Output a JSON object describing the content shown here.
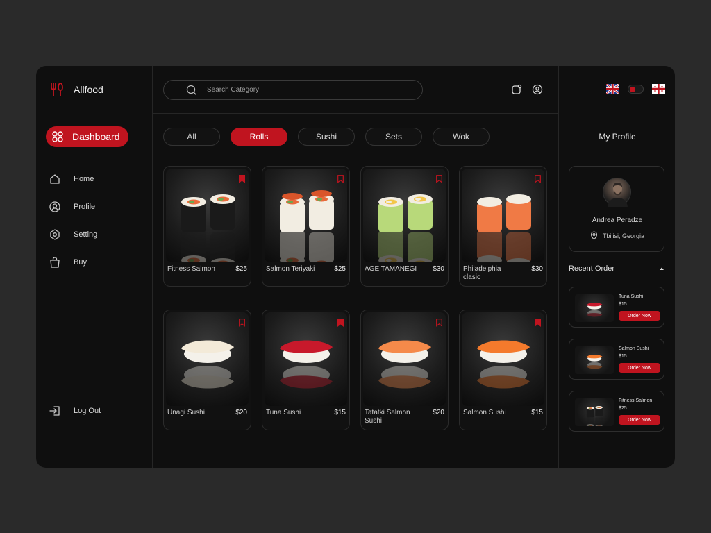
{
  "brand": {
    "name": "Allfood",
    "accent": "#c0141f"
  },
  "sidebar": {
    "dashboard_label": "Dashboard",
    "items": [
      {
        "label": "Home",
        "icon": "home-icon"
      },
      {
        "label": "Profile",
        "icon": "user-icon"
      },
      {
        "label": "Setting",
        "icon": "settings-icon"
      },
      {
        "label": "Buy",
        "icon": "shopping-bag-icon"
      }
    ],
    "logout_label": "Log Out"
  },
  "search": {
    "placeholder": "Search Category"
  },
  "tabs": [
    {
      "label": "All",
      "active": false
    },
    {
      "label": "Rolls",
      "active": true
    },
    {
      "label": "Sushi",
      "active": false
    },
    {
      "label": "Sets",
      "active": false
    },
    {
      "label": "Wok",
      "active": false
    }
  ],
  "products": [
    {
      "name": "Fitness Salmon",
      "price": "$25",
      "kind": "roll-nori"
    },
    {
      "name": "Salmon Teriyaki",
      "price": "$25",
      "kind": "roll-teriyaki"
    },
    {
      "name": "AGE TAMANEGI",
      "price": "$30",
      "kind": "roll-avocado"
    },
    {
      "name": "Philadelphia clasic",
      "price": "$30",
      "kind": "roll-salmon"
    },
    {
      "name": "Unagi Sushi",
      "price": "$20",
      "kind": "nigiri-white"
    },
    {
      "name": "Tuna Sushi",
      "price": "$15",
      "kind": "nigiri-tuna"
    },
    {
      "name": "Tatatki Salmon Sushi",
      "price": "$20",
      "kind": "nigiri-shrimp"
    },
    {
      "name": "Salmon Sushi",
      "price": "$15",
      "kind": "nigiri-salmon"
    }
  ],
  "profile": {
    "title": "My Profile",
    "name": "Andrea Peradze",
    "location": "Tbilisi, Georgia"
  },
  "recent": {
    "title": "Recent Order",
    "orders": [
      {
        "name": "Tuna Sushi",
        "price": "$15",
        "button": "Order Now",
        "kind": "nigiri-tuna"
      },
      {
        "name": "Salmon Sushi",
        "price": "$15",
        "button": "Order Now",
        "kind": "nigiri-salmon"
      },
      {
        "name": "Fitness Salmon",
        "price": "$25",
        "button": "Order Now",
        "kind": "roll-nori"
      }
    ]
  }
}
